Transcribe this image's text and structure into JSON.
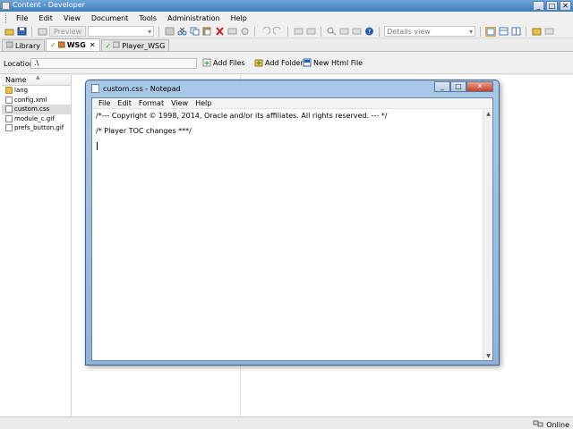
{
  "app": {
    "title": "Content - Developer",
    "window_buttons": {
      "minimize": "_",
      "maximize": "□",
      "close": "✕"
    }
  },
  "menubar": {
    "items": [
      "File",
      "Edit",
      "View",
      "Document",
      "Tools",
      "Administration",
      "Help"
    ]
  },
  "toolbar": {
    "preview_label": "Preview",
    "view_combo_value": "Details view",
    "icons": [
      "new-icon",
      "save-icon",
      "preview-icon",
      "cut-icon",
      "copy-icon",
      "paste-icon",
      "delete-icon",
      "undo-icon",
      "redo-icon",
      "find-icon",
      "help-icon",
      "layout-icon",
      "settings-icon",
      "refresh-icon"
    ]
  },
  "tabs": [
    {
      "label": "Library",
      "active": false
    },
    {
      "label": "WSG",
      "active": true
    },
    {
      "label": "Player_WSG",
      "active": false
    }
  ],
  "location": {
    "label": "Location:",
    "value": ".\\",
    "actions": [
      "Add Files",
      "Add Folder",
      "New Html File"
    ]
  },
  "filelist": {
    "column_name": "Name",
    "items": [
      {
        "name": "lang",
        "type": "folder"
      },
      {
        "name": "config.xml",
        "type": "file"
      },
      {
        "name": "custom.css",
        "type": "file",
        "selected": true
      },
      {
        "name": "module_c.gif",
        "type": "file"
      },
      {
        "name": "prefs_button.gif",
        "type": "file"
      }
    ]
  },
  "notepad": {
    "title": "custom.css - Notepad",
    "menu": [
      "File",
      "Edit",
      "Format",
      "View",
      "Help"
    ],
    "lines": [
      "/*--- Copyright © 1998, 2014, Oracle and/or its affiliates.  All rights reserved. --- */",
      "/* Player TOC changes ***/"
    ]
  },
  "status": {
    "online_label": "Online"
  },
  "colors": {
    "title_blue": "#3d7dbd",
    "notepad_frame": "#a9c8e8",
    "close_red": "#c5432b",
    "check_green": "#2a9a2a"
  }
}
